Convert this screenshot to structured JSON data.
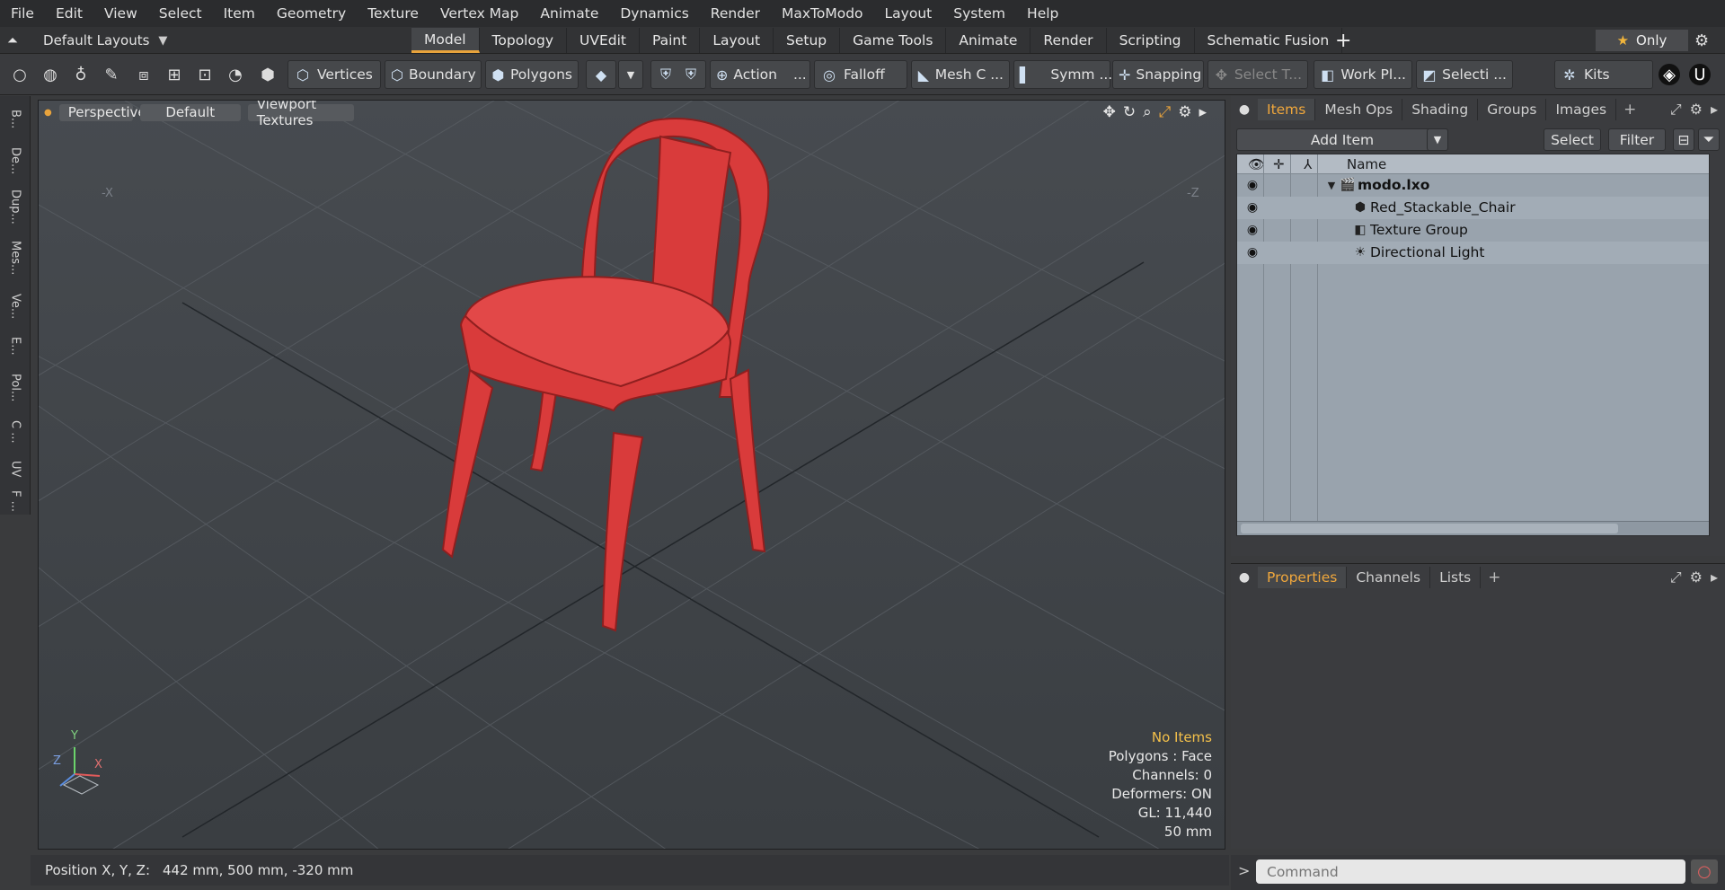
{
  "menu": [
    "File",
    "Edit",
    "View",
    "Select",
    "Item",
    "Geometry",
    "Texture",
    "Vertex Map",
    "Animate",
    "Dynamics",
    "Render",
    "MaxToModo",
    "Layout",
    "System",
    "Help"
  ],
  "layout_switcher": "Default Layouts",
  "layout_tabs": [
    "Model",
    "Topology",
    "UVEdit",
    "Paint",
    "Layout",
    "Setup",
    "Game Tools",
    "Animate",
    "Render",
    "Scripting",
    "Schematic Fusion"
  ],
  "active_layout_tab": "Model",
  "only_button": "Only",
  "toolbar": {
    "vertices": "Vertices",
    "boundary": "Boundary",
    "polygons": "Polygons",
    "action": "Action",
    "action_more": "...",
    "falloff": "Falloff",
    "mesh_c": "Mesh C ...",
    "symm": "Symm ...",
    "snapping": "Snapping",
    "select_t": "Select T...",
    "work_pl": "Work Pl...",
    "selecti": "Selecti ...",
    "kits": "Kits"
  },
  "left_tabs": [
    "B...",
    "De...",
    "Dup...",
    "Mes...",
    "Ve...",
    "E...",
    "Pol...",
    "C ...",
    "UV",
    "F ..."
  ],
  "viewport": {
    "view": "Perspective",
    "style": "Default",
    "textures": "Viewport Textures",
    "axis_neg_x": "-X",
    "axis_neg_z": "-Z",
    "gizmo": {
      "y": "Y",
      "x": "X",
      "z": "Z"
    },
    "stats": [
      "No Items",
      "Polygons : Face",
      "Channels: 0",
      "Deformers: ON",
      "GL: 11,440",
      "50 mm"
    ]
  },
  "status": {
    "label": "Position X, Y, Z:",
    "value": "442 mm, 500 mm, -320 mm"
  },
  "items_panel": {
    "tabs": [
      "Items",
      "Mesh Ops",
      "Shading",
      "Groups",
      "Images"
    ],
    "active_tab": "Items",
    "add_item": "Add Item",
    "select": "Select",
    "filter": "Filter",
    "column_name": "Name",
    "tree": [
      {
        "name": "modo.lxo",
        "icon": "scene-icon",
        "bold": true
      },
      {
        "name": "Red_Stackable_Chair",
        "icon": "mesh-icon",
        "bold": false
      },
      {
        "name": "Texture Group",
        "icon": "texture-group-icon",
        "bold": false
      },
      {
        "name": "Directional Light",
        "icon": "light-icon",
        "bold": false
      }
    ]
  },
  "properties_panel": {
    "tabs": [
      "Properties",
      "Channels",
      "Lists"
    ],
    "active_tab": "Properties"
  },
  "command": {
    "prompt": ">",
    "placeholder": "Command"
  },
  "colors": {
    "accent": "#e8a33c",
    "chair": "#d83a3a",
    "viewport_bg": "#43474b"
  }
}
